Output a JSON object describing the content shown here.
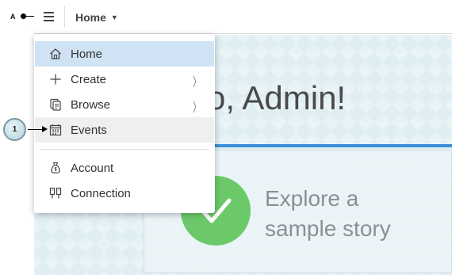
{
  "annotations": {
    "a_label": "A",
    "badge_number": "1"
  },
  "topbar": {
    "breadcrumb": "Home",
    "caret": "▼"
  },
  "content": {
    "welcome_text": "o, Admin!",
    "explore_line1": "Explore a",
    "explore_line2": "sample story",
    "accent_color": "#3a8fd6",
    "check_color": "#6cc96a"
  },
  "menu": {
    "items": [
      {
        "label": "Home",
        "icon": "home-icon",
        "state": "selected",
        "submenu": false
      },
      {
        "label": "Create",
        "icon": "plus-icon",
        "submenu": true
      },
      {
        "label": "Browse",
        "icon": "browse-icon",
        "submenu": true
      },
      {
        "label": "Events",
        "icon": "calendar-icon",
        "state": "hover",
        "submenu": false
      },
      {
        "label": "Account",
        "icon": "money-bag-icon",
        "submenu": false
      },
      {
        "label": "Connection",
        "icon": "connection-icon",
        "submenu": false
      }
    ],
    "chevron": "〉"
  }
}
